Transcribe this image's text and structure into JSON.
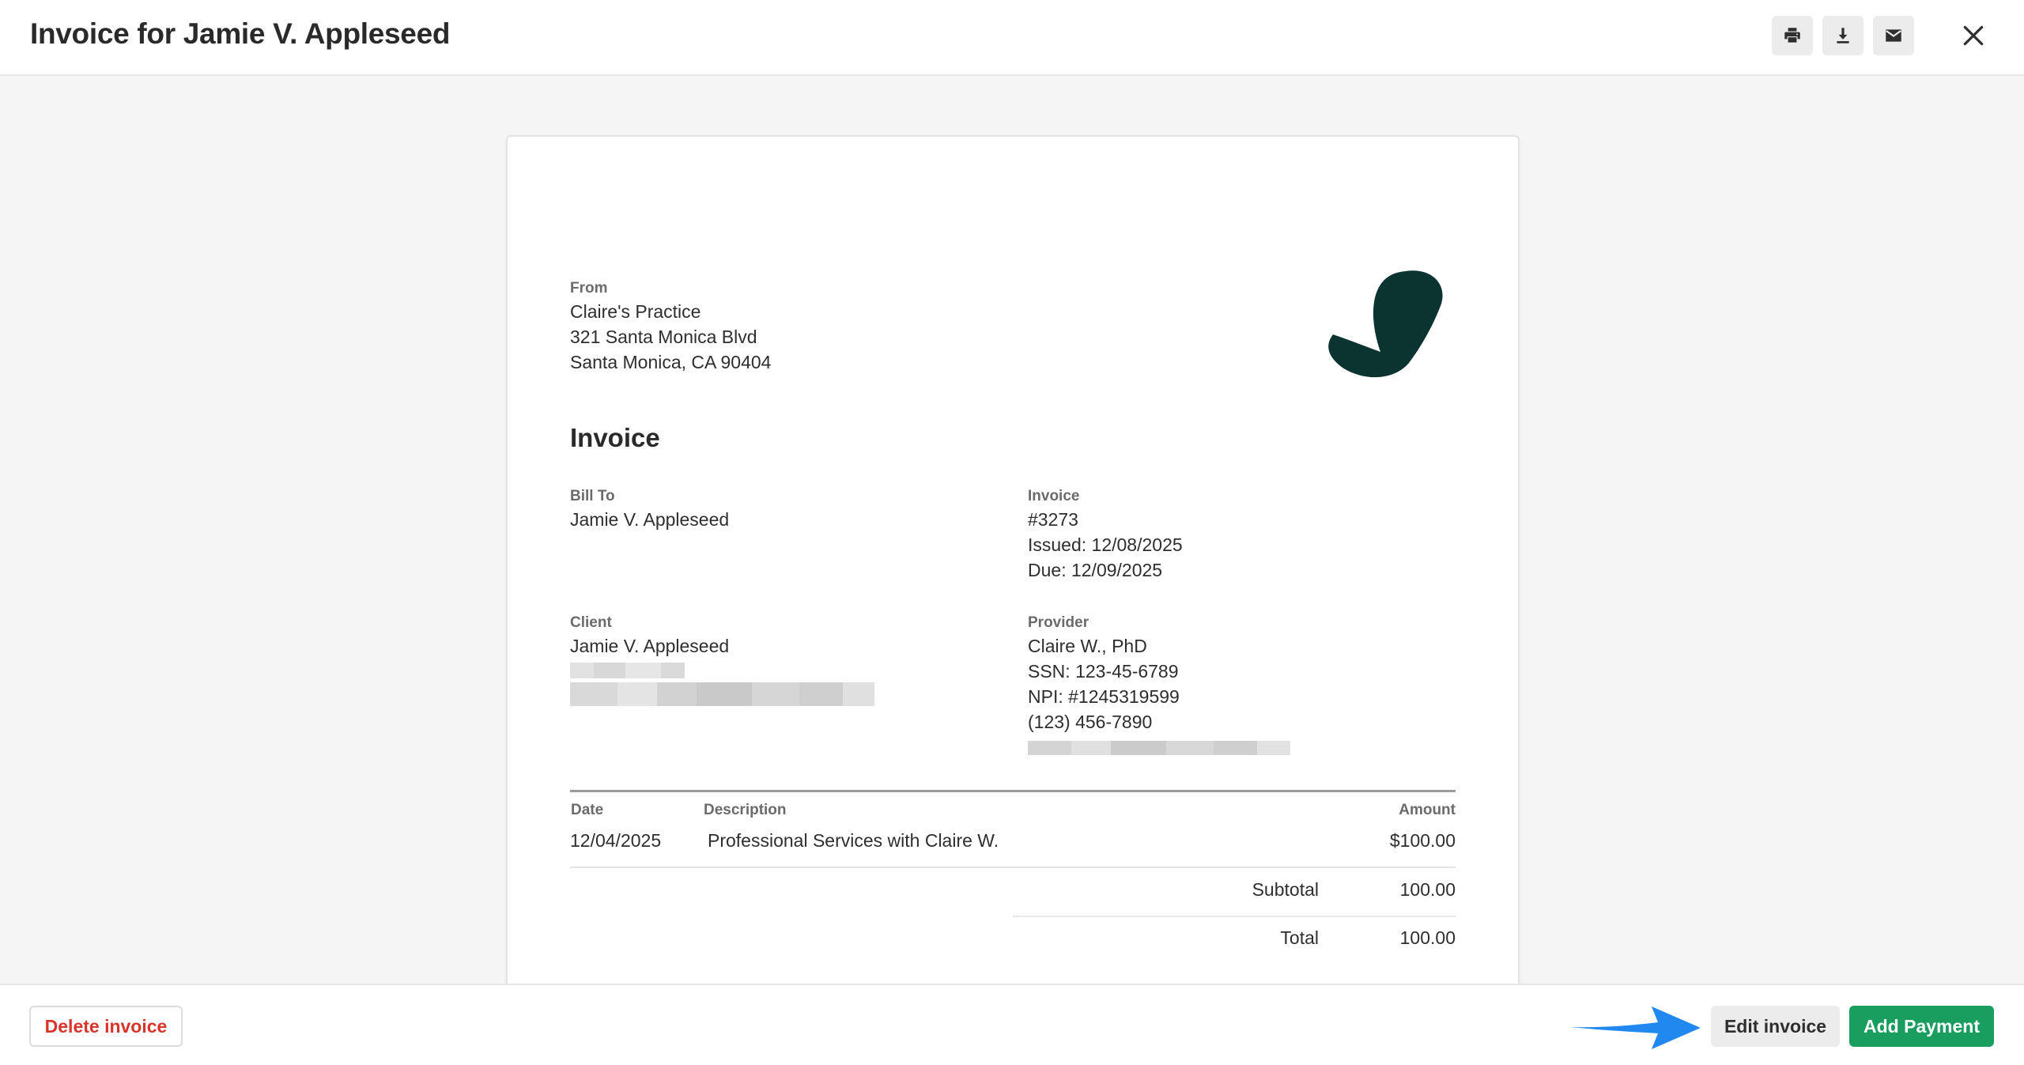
{
  "header": {
    "title": "Invoice for Jamie V. Appleseed",
    "icons": [
      "print-icon",
      "download-icon",
      "email-icon",
      "close-icon"
    ]
  },
  "invoice": {
    "from_label": "From",
    "from_lines": [
      "Claire's Practice",
      "321 Santa Monica Blvd",
      "Santa Monica, CA 90404"
    ],
    "title": "Invoice",
    "bill_to_label": "Bill To",
    "bill_to_name": "Jamie V. Appleseed",
    "invoice_label": "Invoice",
    "invoice_number": "#3273",
    "issued": "Issued: 12/08/2025",
    "due": "Due: 12/09/2025",
    "client_label": "Client",
    "client_name": "Jamie V. Appleseed",
    "provider_label": "Provider",
    "provider_lines": [
      "Claire W., PhD",
      "SSN: 123-45-6789",
      "NPI: #1245319599",
      "(123) 456-7890"
    ],
    "table": {
      "headers": {
        "date": "Date",
        "description": "Description",
        "amount": "Amount"
      },
      "rows": [
        {
          "date": "12/04/2025",
          "description": "Professional Services with Claire W.",
          "amount": "$100.00"
        }
      ]
    },
    "subtotal_label": "Subtotal",
    "subtotal_value": "100.00",
    "total_label": "Total",
    "total_value": "100.00"
  },
  "footer": {
    "delete_label": "Delete invoice",
    "edit_label": "Edit invoice",
    "add_payment_label": "Add Payment"
  },
  "colors": {
    "logo": "#0b3330",
    "delete": "#d8342a",
    "primary": "#1a9e5f",
    "arrow": "#2188f0"
  }
}
